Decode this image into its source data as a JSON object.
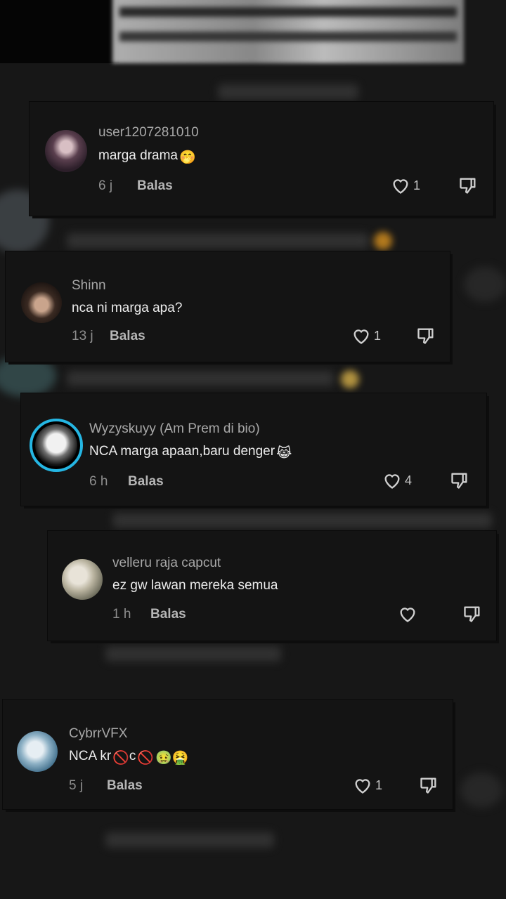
{
  "colors": {
    "background": "#171717",
    "card": "#141414",
    "ring": "#25b6e3"
  },
  "comments": [
    {
      "username": "user1207281010",
      "text": "marga drama",
      "emoji": "🤭",
      "time": "6 j",
      "reply": "Balas",
      "likes": "1"
    },
    {
      "username": "Shinn",
      "text": "nca ni marga apa?",
      "emoji": "",
      "time": "13 j",
      "reply": "Balas",
      "likes": "1"
    },
    {
      "username": "Wyzyskuyy (Am Prem di bio)",
      "text": "NCA marga apaan,baru denger",
      "emoji": "😹",
      "time": "6 h",
      "reply": "Balas",
      "likes": "4"
    },
    {
      "username": "velleru raja capcut",
      "text": "ez gw lawan mereka semua",
      "emoji": "",
      "time": "1 h",
      "reply": "Balas",
      "likes": ""
    },
    {
      "username": "CybrrVFX",
      "text_a": "NCA kr",
      "text_b": "c",
      "emoji_a": "🚫",
      "emoji_b": "🚫",
      "emoji_c": "🤢🤮",
      "time": "5 j",
      "reply": "Balas",
      "likes": "1"
    }
  ],
  "icons": {
    "like": "heart-icon",
    "dislike": "thumbs-down-icon"
  }
}
